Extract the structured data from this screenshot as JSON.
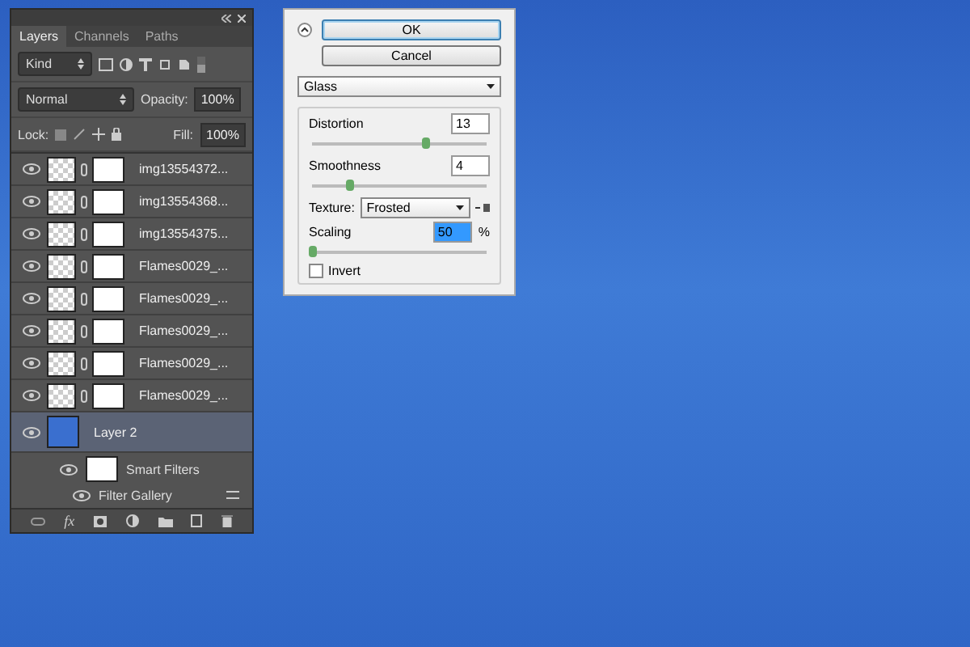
{
  "panel": {
    "tabs": [
      {
        "label": "Layers",
        "selected": true
      },
      {
        "label": "Channels",
        "selected": false
      },
      {
        "label": "Paths",
        "selected": false
      }
    ],
    "filter_kind": "Kind",
    "blend_mode": "Normal",
    "opacity_label": "Opacity:",
    "opacity": "100%",
    "lock_label": "Lock:",
    "fill_label": "Fill:",
    "fill": "100%",
    "layers": [
      {
        "name": "img13554372...",
        "selected": false,
        "visible": true
      },
      {
        "name": "img13554368...",
        "selected": false,
        "visible": true
      },
      {
        "name": "img13554375...",
        "selected": false,
        "visible": true
      },
      {
        "name": "Flames0029_...",
        "selected": false,
        "visible": true
      },
      {
        "name": "Flames0029_...",
        "selected": false,
        "visible": true
      },
      {
        "name": "Flames0029_...",
        "selected": false,
        "visible": true
      },
      {
        "name": "Flames0029_...",
        "selected": false,
        "visible": true
      },
      {
        "name": "Flames0029_...",
        "selected": false,
        "visible": true
      },
      {
        "name": "Layer 2",
        "selected": true,
        "visible": true,
        "children": [
          {
            "name": "Smart Filters",
            "kind": "group"
          },
          {
            "name": "Filter Gallery",
            "kind": "filter"
          }
        ]
      }
    ],
    "footer_fx": "fx"
  },
  "dialog": {
    "ok": "OK",
    "cancel": "Cancel",
    "filter": "Glass",
    "controls": [
      {
        "kind": "slider",
        "label": "Distortion",
        "value": "13",
        "level": 0.65
      },
      {
        "kind": "slider",
        "label": "Smoothness",
        "value": "4",
        "level": 0.21
      },
      {
        "kind": "select",
        "label": "Texture:",
        "value": "Frosted"
      },
      {
        "kind": "slider",
        "label": "Scaling",
        "value": "50",
        "unit": "%",
        "level": 0
      },
      {
        "kind": "checkbox",
        "label": "Invert",
        "checked": false
      }
    ]
  }
}
